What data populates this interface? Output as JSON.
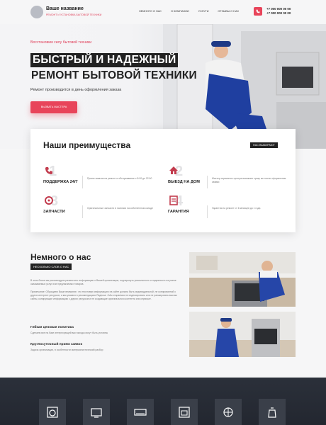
{
  "header": {
    "brand_name": "Ваше название",
    "brand_sub": "РЕМОНТ И УСТАНОВКА БЫТОВОЙ ТЕХНИКИ",
    "nav": [
      "НЕМНОГО О НАС",
      "О КОМПАНИИ",
      "УСЛУГИ",
      "ОТЗЫВЫ О НАС"
    ],
    "phones": [
      "+7 000 000 00 00",
      "+7 000 000 00 00"
    ]
  },
  "hero": {
    "kicker": "Восстановим силу бытовой техники",
    "title_line1": "БЫСТРЫЙ И НАДЕЖНЫЙ",
    "title_line2": "РЕМОНТ БЫТОВОЙ ТЕХНИКИ",
    "desc": "Ремонт производится в день оформления заказа",
    "cta": "ВЫЗВАТЬ МАСТЕРА"
  },
  "advantages": {
    "title": "Наши преимущества",
    "badge": "НАС ВЫБИРАЮТ",
    "items": [
      {
        "num": "1",
        "name": "ПОДДЕРЖКА 24/7",
        "text": "Прием заказов на ремонт и обслуживание с 8:00 до 22:00"
      },
      {
        "num": "2",
        "name": "ВЫЕЗД НА ДОМ",
        "text": "Мастер сервисного центра выезжает сразу же после оформления заявки"
      },
      {
        "num": "3",
        "name": "ЗАПЧАСТИ",
        "text": "Оригинальные запчасти в наличии на собственном складе"
      },
      {
        "num": "4",
        "name": "ГАРАНТИЯ",
        "text": "Гарантия на ремонт от 6 месяцев до 1 года"
      }
    ]
  },
  "about": {
    "title": "Немного о нас",
    "badge": "НЕСКОЛЬКО СЛОВ О НАС",
    "p1": "В этом блоке мы рекомендуем разместить информацию о Вашей организации, подчеркнуть уникальность и надежность на рынке оказываемых услуг или предлагаемых товаров.",
    "p2": "Примечание: Обращаем Ваше внимание, что текстовую информацию на сайте должна быть индивидуальной, не копированной с других интернет-ресурсов, а как указано в рекомендациях Яндекса: «Мы стараемся не индексировать или не ранжировать высоко сайты, копирующие информацию с других ресурсов и не создающие оригинального контента или сервиса».",
    "f1_title": "Гибкая ценовая политика",
    "f1_text": "Сделаем все на базе интересующей вас выгоды могут быть условны",
    "f2_title": "Круглосуточный прием заявок",
    "f2_text": "Задача организации, в особенности материалистический разбор"
  },
  "colors": {
    "accent": "#e8445a",
    "dark": "#2b303a"
  }
}
